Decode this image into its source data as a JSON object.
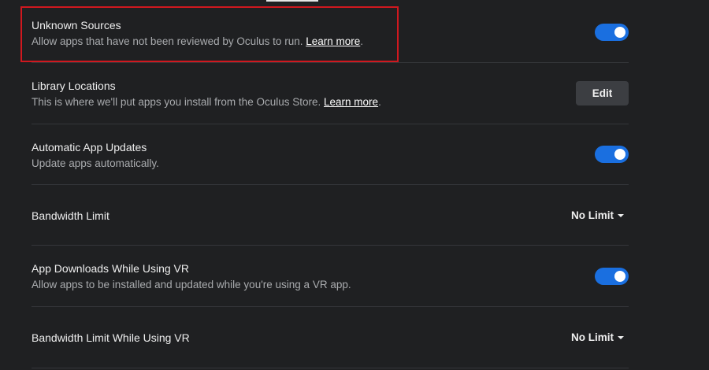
{
  "settings": {
    "unknown_sources": {
      "title": "Unknown Sources",
      "desc": "Allow apps that have not been reviewed by Oculus to run.",
      "link": "Learn more",
      "desc_end": ".",
      "enabled": true
    },
    "library_locations": {
      "title": "Library Locations",
      "desc": "This is where we'll put apps you install from the Oculus Store.",
      "link": "Learn more",
      "desc_end": ".",
      "button": "Edit"
    },
    "auto_updates": {
      "title": "Automatic App Updates",
      "desc": "Update apps automatically.",
      "enabled": true
    },
    "bandwidth_limit": {
      "title": "Bandwidth Limit",
      "value": "No Limit"
    },
    "downloads_vr": {
      "title": "App Downloads While Using VR",
      "desc": "Allow apps to be installed and updated while you're using a VR app.",
      "enabled": true
    },
    "bandwidth_limit_vr": {
      "title": "Bandwidth Limit While Using VR",
      "value": "No Limit"
    }
  },
  "colors": {
    "background": "#1f2022",
    "toggle_on": "#1a6fe0",
    "highlight": "#d0181f",
    "divider": "#34363a"
  }
}
